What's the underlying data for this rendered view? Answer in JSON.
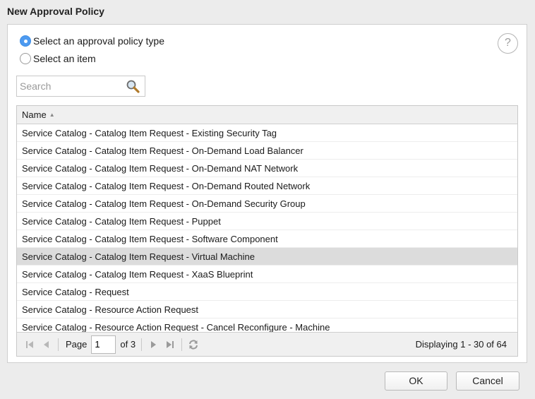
{
  "dialog": {
    "title": "New Approval Policy"
  },
  "selection": {
    "options": [
      {
        "label": "Select an approval policy type",
        "checked": true
      },
      {
        "label": "Select an item",
        "checked": false
      }
    ]
  },
  "help": {
    "label": "?"
  },
  "search": {
    "placeholder": "Search",
    "value": ""
  },
  "grid": {
    "column_header": "Name",
    "sort_indicator": "▲",
    "sort": "ascending",
    "rows": [
      "Service Catalog - Catalog Item Request - Existing Security Tag",
      "Service Catalog - Catalog Item Request - On-Demand Load Balancer",
      "Service Catalog - Catalog Item Request - On-Demand NAT Network",
      "Service Catalog - Catalog Item Request - On-Demand Routed Network",
      "Service Catalog - Catalog Item Request - On-Demand Security Group",
      "Service Catalog - Catalog Item Request - Puppet",
      "Service Catalog - Catalog Item Request - Software Component",
      "Service Catalog - Catalog Item Request - Virtual Machine",
      "Service Catalog - Catalog Item Request - XaaS Blueprint",
      "Service Catalog - Request",
      "Service Catalog - Resource Action Request",
      "Service Catalog - Resource Action Request - Cancel Reconfigure - Machine"
    ],
    "selected_row": "Service Catalog - Catalog Item Request - Virtual Machine"
  },
  "pager": {
    "page_label": "Page",
    "page_value": "1",
    "of_label": "of 3",
    "displaying": "Displaying 1 - 30 of 64"
  },
  "buttons": {
    "ok": "OK",
    "cancel": "Cancel"
  },
  "colors": {
    "selected_row": "#dcdcdc",
    "radio_checked": "#4d9af0",
    "panel_bg": "#ffffff",
    "dialog_bg": "#ececec"
  }
}
